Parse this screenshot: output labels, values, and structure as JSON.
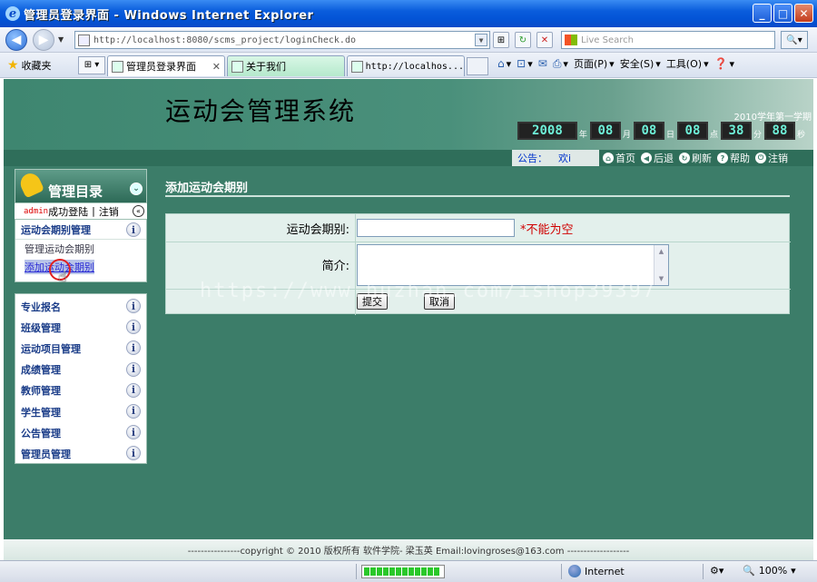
{
  "window": {
    "title": "管理员登录界面 - Windows Internet Explorer"
  },
  "addressbar": {
    "url": "http://localhost:8080/scms_project/loginCheck.do",
    "search_placeholder": "Live Search"
  },
  "favorites": {
    "label": "收藏夹"
  },
  "tabs": [
    {
      "label": "管理员登录界面"
    },
    {
      "label": "关于我们"
    },
    {
      "label": "http://localhos..."
    }
  ],
  "commandbar": {
    "page": "页面(P)",
    "safety": "安全(S)",
    "tools": "工具(O)"
  },
  "header": {
    "system_title": "运动会管理系统",
    "term": "2010学年第一学期",
    "clock": [
      {
        "value": "2008",
        "unit": "年"
      },
      {
        "value": "08",
        "unit": "月"
      },
      {
        "value": "08",
        "unit": "日"
      },
      {
        "value": "08",
        "unit": "点"
      },
      {
        "value": "38",
        "unit": "分"
      },
      {
        "value": "88",
        "unit": "秒"
      }
    ]
  },
  "notice": {
    "label": "公告：",
    "message": "欢i"
  },
  "topnav": {
    "home": "首页",
    "back": "后退",
    "refresh": "刷新",
    "help": "帮助",
    "logout": "注销"
  },
  "sidebar": {
    "title": "管理目录",
    "user": "admin",
    "login_status": "成功登陆",
    "logout_link": "注销",
    "section1": {
      "title": "运动会期别管理",
      "items": [
        "管理运动会期别",
        "添加运动会期别"
      ]
    },
    "sections": [
      "专业报名",
      "班级管理",
      "运动项目管理",
      "成绩管理",
      "教师管理",
      "学生管理",
      "公告管理",
      "管理员管理"
    ]
  },
  "main": {
    "title": "添加运动会期别",
    "form": {
      "period_label": "运动会期别:",
      "period_value": "",
      "required_note": "*不能为空",
      "intro_label": "简介:",
      "intro_value": "",
      "submit": "提交",
      "cancel": "取消"
    }
  },
  "watermark": "https://www.huzhan.com/ishop39397",
  "footer": {
    "text": "----------------copyright © 2010 版权所有 软件学院- 梁玉英 Email:lovingroses@163.com -------------------"
  },
  "statusbar": {
    "zone": "Internet",
    "zoom": "100%"
  },
  "colors": {
    "page_bg": "#3c7d69",
    "required": "#d00000",
    "link": "#1a3c88"
  }
}
